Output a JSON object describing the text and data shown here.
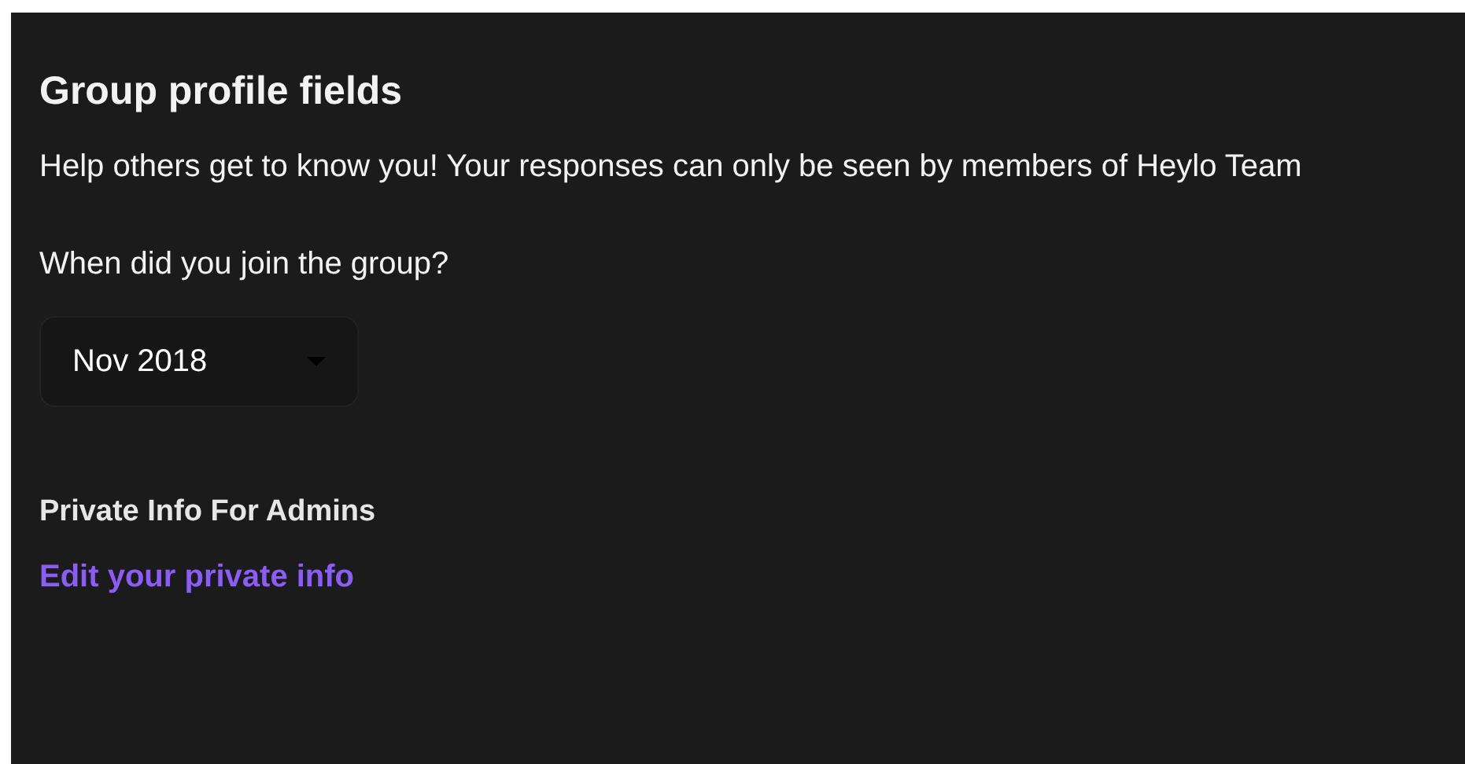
{
  "title": "Group profile fields",
  "description": "Help others get to know you! Your responses can only be seen by members of Heylo Team",
  "question": {
    "label": "When did you join the group?",
    "value": "Nov 2018"
  },
  "private_section": {
    "heading": "Private Info For Admins",
    "link": "Edit your private info"
  }
}
